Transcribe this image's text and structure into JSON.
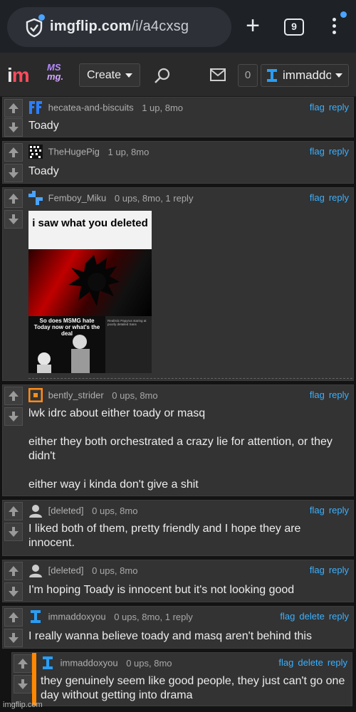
{
  "browser": {
    "url_host": "imgflip.com",
    "url_path": "/i/a4cxsg",
    "tab_count": "9",
    "icons": [
      "secure-site-icon",
      "new-tab-icon",
      "tabs-icon",
      "menu-icon"
    ]
  },
  "site": {
    "logo_main": "i",
    "logo_dot": "m",
    "stream_logo_line1": "MS",
    "stream_logo_line2": "mg.",
    "create_label": "Create",
    "notif_count": "0",
    "username": "immaddoxyou",
    "icons": [
      "search-icon",
      "mail-icon"
    ]
  },
  "comments": [
    {
      "user": "hecatea-and-biscuits",
      "meta": "1 up, 8mo",
      "actions": [
        "flag",
        "reply"
      ],
      "text": "Toady",
      "avatar_color": "#2a7fff"
    },
    {
      "user": "TheHugePig",
      "meta": "1 up, 8mo",
      "actions": [
        "flag",
        "reply"
      ],
      "text": "Toady",
      "avatar_color": "#ffffff"
    },
    {
      "user": "Femboy_Miku",
      "meta": "0 ups, 8mo, 1 reply",
      "actions": [
        "flag",
        "reply"
      ],
      "text": "",
      "avatar_color": "#4aa3ff",
      "meme": {
        "top_text": "i saw what you deleted",
        "bottom_text": "So does MSMG hate Today now or what's the deal",
        "side_text": "Realistic Papyrus staring at poorly detailed Sans"
      }
    },
    {
      "user": "bently_strider",
      "meta": "0 ups, 8mo",
      "actions": [
        "flag",
        "reply"
      ],
      "text": "lwk idrc about either toady or masq\n\neither they both orchestrated a crazy lie for attention, or they didn't\n\neither way i kinda don't give a shit",
      "avatar_color": "#ff8c1a"
    },
    {
      "user": "[deleted]",
      "meta": "0 ups, 8mo",
      "actions": [
        "flag",
        "reply"
      ],
      "text": "I liked both of them, pretty friendly and I hope they are innocent.",
      "avatar_color": "#cccccc"
    },
    {
      "user": "[deleted]",
      "meta": "0 ups, 8mo",
      "actions": [
        "flag",
        "reply"
      ],
      "text": "I'm hoping Toady is innocent but it's not looking good",
      "avatar_color": "#cccccc"
    },
    {
      "user": "immaddoxyou",
      "meta": "0 ups, 8mo, 1 reply",
      "actions": [
        "flag",
        "delete",
        "reply"
      ],
      "text": "I really wanna believe toady and masq aren't behind this",
      "avatar_color": "#2a9df4"
    },
    {
      "user": "immaddoxyou",
      "meta": "0 ups, 8mo",
      "actions": [
        "flag",
        "delete",
        "reply"
      ],
      "text": "they genuinely seem like good people, they just can't go one day without getting into drama",
      "avatar_color": "#2a9df4"
    }
  ],
  "footer_watermark": "imgflip.com",
  "colors": {
    "link": "#3ab0ff",
    "reply_bar": "#ff8800",
    "comment_bg": "#333333"
  }
}
